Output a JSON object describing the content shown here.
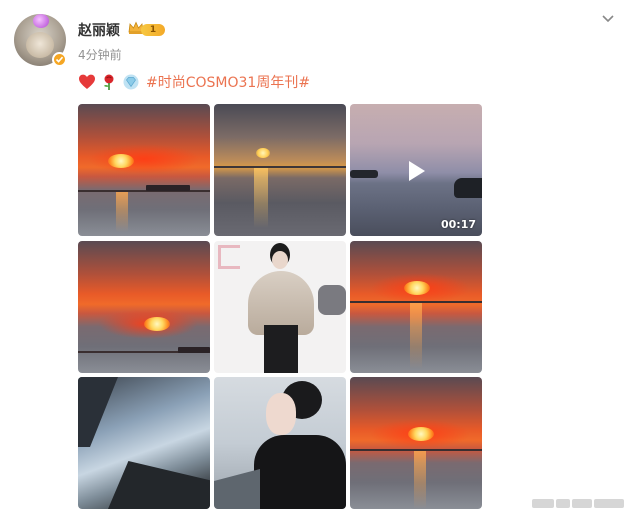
{
  "user": {
    "name": "赵丽颖",
    "level": "1",
    "time": "4分钟前"
  },
  "post": {
    "topic": "#时尚COSMO31周年刊#",
    "emojis": [
      "heart-icon",
      "rose-icon",
      "diamond-icon"
    ]
  },
  "media": {
    "video_duration": "00:17",
    "count": 9
  },
  "colors": {
    "topic": "#eb7350",
    "time": "#939393",
    "badge": "#f5a623"
  }
}
